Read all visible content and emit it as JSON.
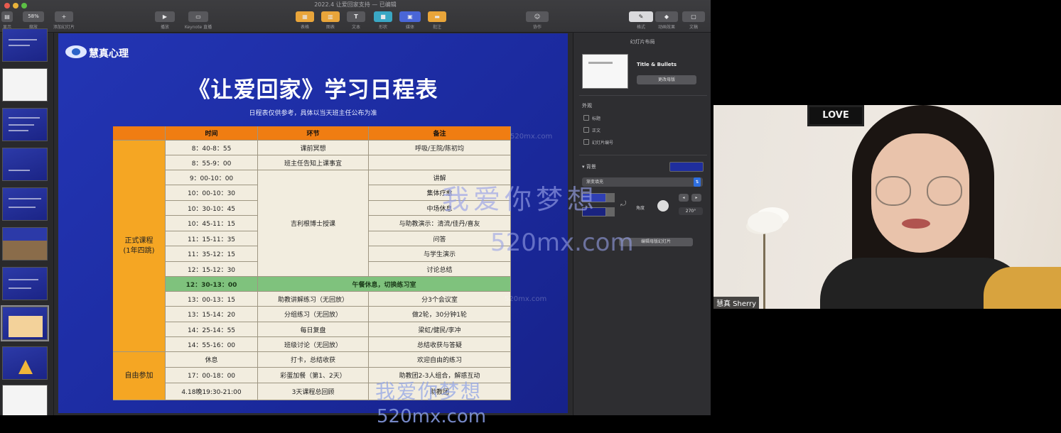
{
  "keynote": {
    "document_title": "2022.4 让爱回家支持 — 已编辑",
    "toolbar": {
      "view_label": "显示",
      "zoom_value": "58%",
      "zoom_label": "缩放",
      "add_slide_label": "添加幻灯片",
      "play_label": "播放",
      "keynote_live_label": "Keynote 直播",
      "table_label": "表格",
      "chart_label": "图表",
      "text_label": "文本",
      "shape_label": "形状",
      "media_label": "媒体",
      "comment_label": "批注",
      "collaborate_label": "协作",
      "format_label": "格式",
      "animate_label": "动画效果",
      "document_label": "文稿",
      "accent_color": "#e9a53a"
    },
    "inspector": {
      "header": "幻灯片布局",
      "layout_name": "Title & Bullets",
      "change_master_btn": "更改母版",
      "appearance_label": "外观",
      "checkbox_title": "标题",
      "checkbox_body": "正文",
      "checkbox_slide_number": "幻灯片编号",
      "background_label": "背景",
      "fill_type": "渐变填充",
      "angle_label": "角度",
      "angle_value": "270°",
      "edit_master_btn": "编辑母版幻灯片",
      "gradient_color": "#1f2e9e"
    }
  },
  "slide": {
    "logo_text": "慧真心理",
    "title": "《让爱回家》学习日程表",
    "subtitle": "日程表仅供参考，具体以当天班主任公布为准",
    "table": {
      "headers": [
        "时间",
        "环节",
        "备注"
      ],
      "categories": {
        "formal": "正式课程\n(1年四跳)",
        "free": "自由参加"
      },
      "times": [
        "8：40-8：55",
        "8：55-9：00",
        "9：00-10：00",
        "10：00-10：30",
        "10：30-10：45",
        "10：45-11：15",
        "11：15-11：35",
        "11：35-12：15",
        "12：15-12：30",
        "12：30-13：00",
        "13：00-13：15",
        "13：15-14：20",
        "14：25-14：55",
        "14：55-16：00",
        "休息",
        "17：00-18：00",
        "4.18晚19:30-21:00"
      ],
      "segments": [
        "课前冥想",
        "班主任告知上课事宜",
        "吉利根博士授课",
        "午餐休息，切换练习室",
        "助教讲解练习（无回放）",
        "分组练习（无回放）",
        "每日复盘",
        "班级讨论（无回放）",
        "打卡，总结收获",
        "彩蛋加餐（第1、2天）",
        "3天课程总回顾"
      ],
      "notes": [
        "呼吸/王院/陈初均",
        "",
        "讲解",
        "集体疗愈",
        "中场休息",
        "与助教演示：清流/佳丹/喜友",
        "问答",
        "与学生演示",
        "讨论总结",
        "分3个会议室",
        "做2轮，30分钟1轮",
        "梁虹/健民/李冲",
        "总结收获与答疑",
        "欢迎自由的练习",
        "助教团2-3人组合，解惑互动",
        "助教团"
      ],
      "header_color": "#f07d12",
      "lunch_color": "#7fc27d"
    }
  },
  "webcam": {
    "name_tag": "慧真 Sherry",
    "sign_text": "LOVE"
  },
  "watermarks": {
    "cn": "我爱你梦想",
    "url": "520mx.com"
  }
}
